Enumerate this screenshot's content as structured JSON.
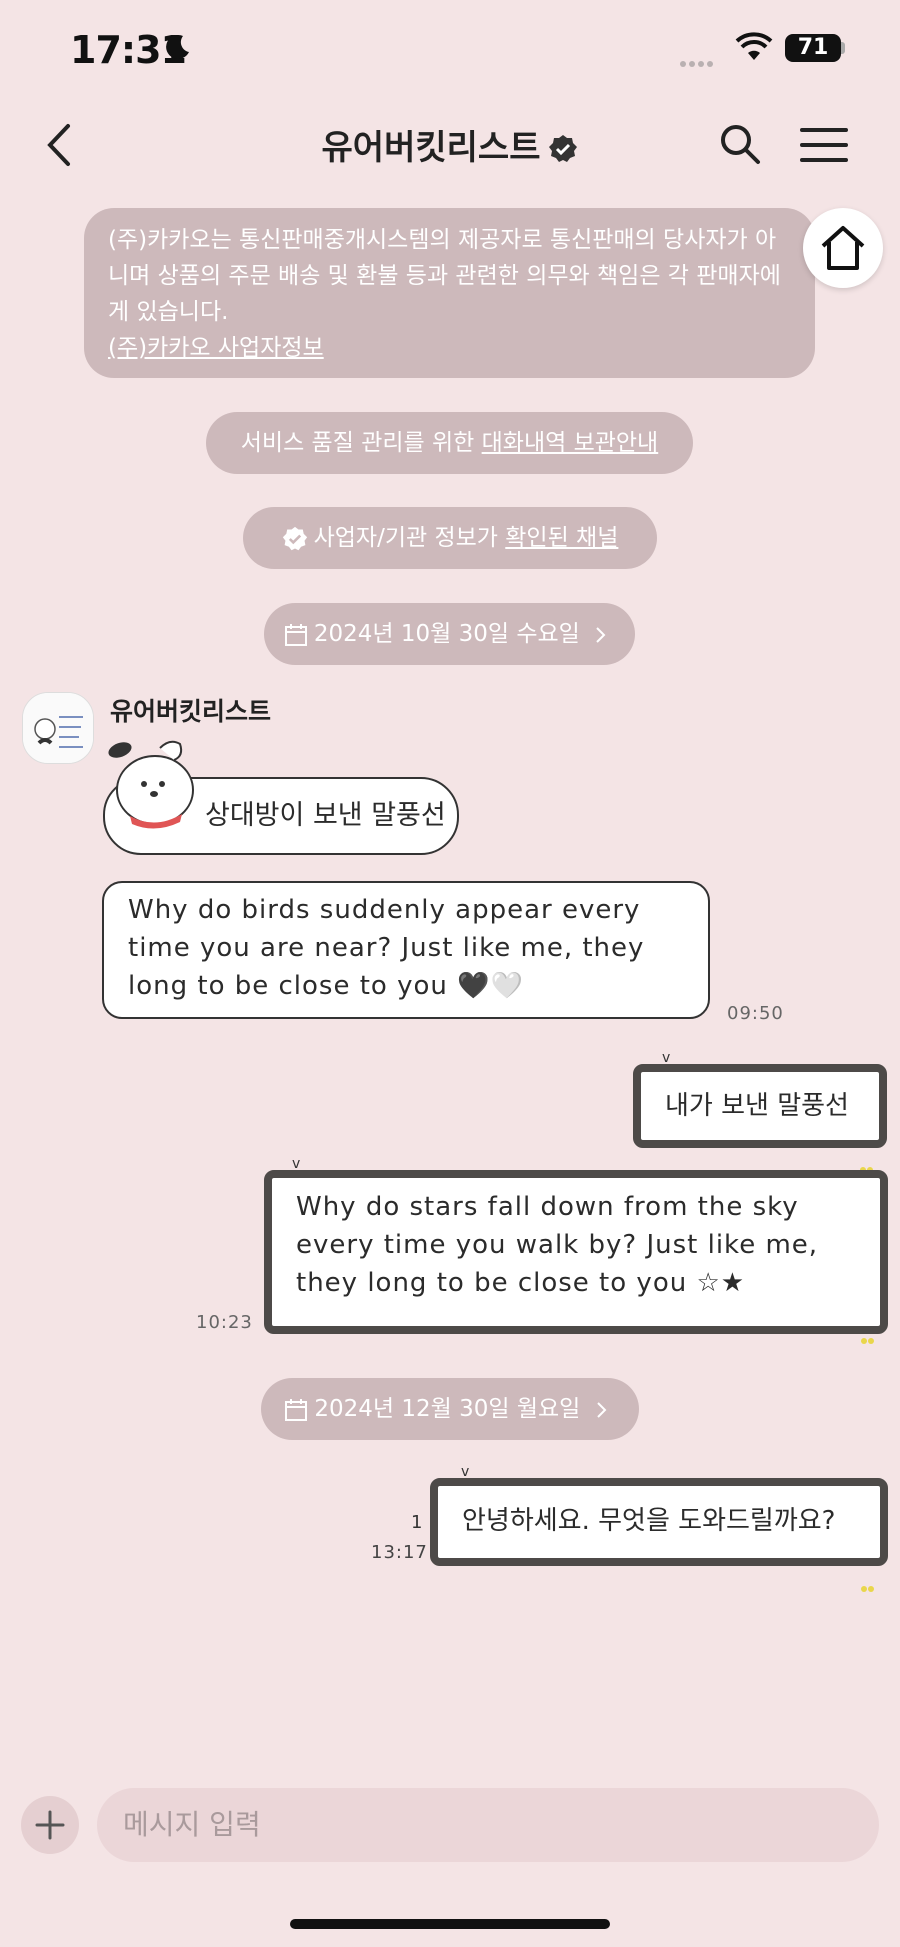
{
  "status_bar": {
    "time": "17:31",
    "battery": "71"
  },
  "header": {
    "title": "유어버킷리스트"
  },
  "notice": {
    "text": "(주)카카오는 통신판매중개시스템의 제공자로 통신판매의 당사자가 아니며 상품의 주문 배송 및 환불 등과 관련한 의무와 책임은 각 판매자에게 있습니다.",
    "link": "(주)카카오 사업자정보"
  },
  "service_notice": {
    "text": "서비스 품질 관리를 위한 ",
    "link": "대화내역 보관안내"
  },
  "verified_notice": {
    "text": "사업자/기관 정보가 ",
    "link": "확인된 채널"
  },
  "dates": [
    "2024년 10월 30일 수요일",
    "2024년 12월 30일 월요일"
  ],
  "sender": {
    "name": "유어버킷리스트"
  },
  "messages": [
    {
      "direction": "in",
      "text": "상대방이 보낸 말풍선"
    },
    {
      "direction": "in",
      "text": "Why do birds suddenly appear every time you are near? Just like me, they long to be close to you 🖤🤍",
      "time": "09:50"
    },
    {
      "direction": "out",
      "text": "내가 보낸 말풍선"
    },
    {
      "direction": "out",
      "text": "Why do stars fall down from the sky every time you walk by? Just like me, they long to be close to you ☆★",
      "time": "10:23"
    },
    {
      "direction": "out",
      "text": "안녕하세요. 무엇을 도와드릴까요?",
      "time": "13:17",
      "unread": "1"
    }
  ],
  "input": {
    "placeholder": "메시지 입력"
  },
  "icons": [
    "back-icon",
    "verified-icon",
    "search-icon",
    "menu-icon",
    "home-icon",
    "calendar-icon",
    "plus-icon",
    "chevron-right-icon"
  ],
  "colors": {
    "background": "#f4e4e5",
    "notice": "#cdb9bb",
    "out_border": "#4d4a48"
  }
}
